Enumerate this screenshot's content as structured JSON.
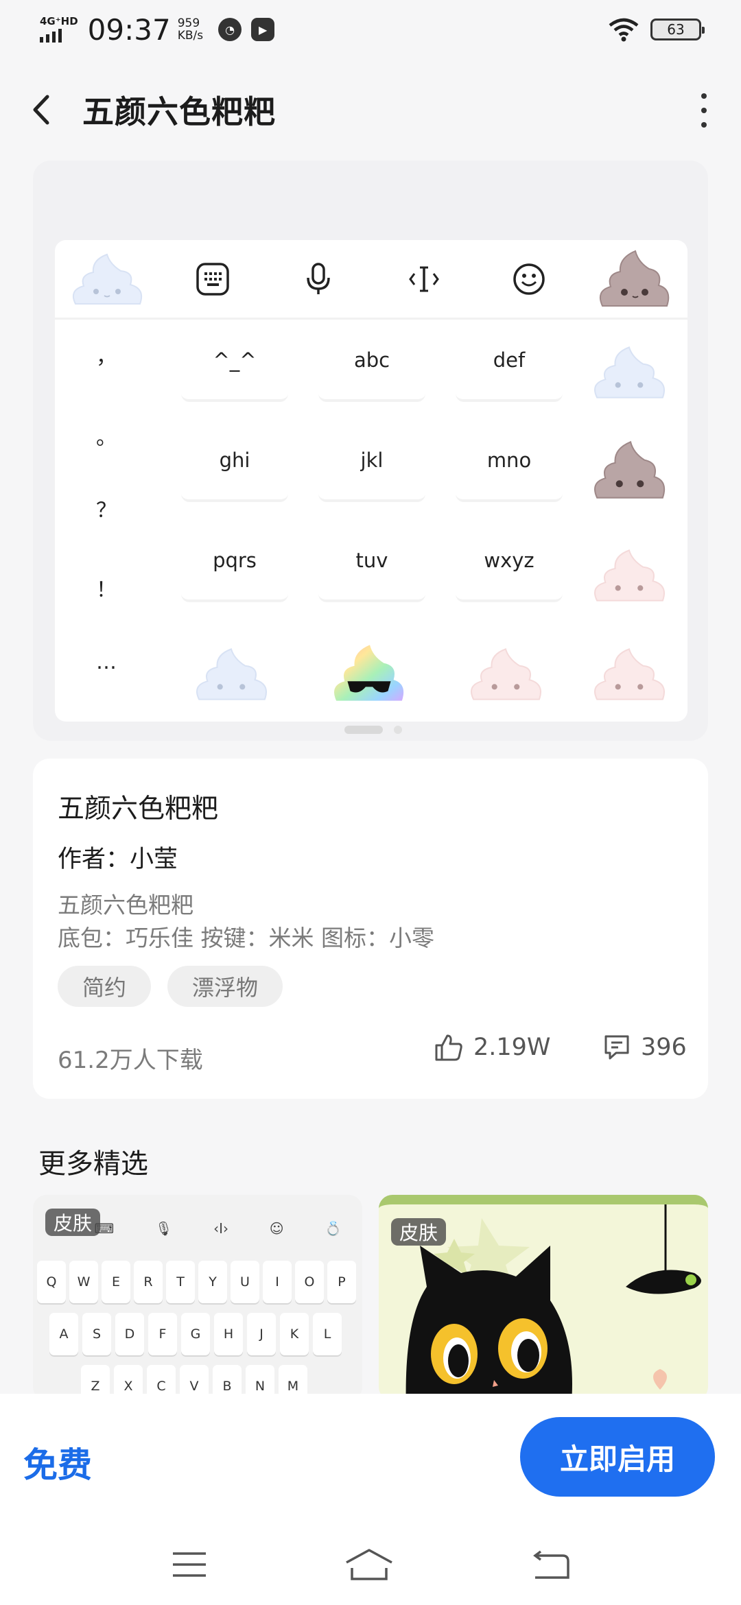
{
  "status": {
    "network": "4G⁺HD",
    "time": "09:37",
    "speed_value": "959",
    "speed_unit": "KB/s",
    "battery": "63"
  },
  "header": {
    "title": "五颜六色粑粑"
  },
  "keyboard": {
    "toolbar": [
      "poop-icon",
      "keyboard-icon",
      "mic-icon",
      "cursor-icon",
      "emoji-icon",
      "poop-icon"
    ],
    "symbols": [
      "，",
      "。",
      "？",
      "！",
      "…"
    ],
    "keys": [
      "^_^",
      "abc",
      "def",
      "ghi",
      "jkl",
      "mno",
      "pqrs",
      "tuv",
      "wxyz"
    ]
  },
  "detail": {
    "name": "五颜六色粑粑",
    "author_label": "作者：",
    "author": "小莹",
    "description": "五颜六色粑粑",
    "credits": "底包：巧乐佳  按键：米米  图标：小零",
    "tags": [
      "简约",
      "漂浮物"
    ],
    "downloads": "61.2万人下载",
    "likes": "2.19W",
    "comments": "396"
  },
  "more": {
    "title": "更多精选",
    "items": [
      {
        "badge": "皮肤"
      },
      {
        "badge": "皮肤"
      }
    ],
    "qwerty_row1": [
      "Q",
      "W",
      "E",
      "R",
      "T",
      "Y",
      "U",
      "I",
      "O",
      "P"
    ],
    "qwerty_row2": [
      "A",
      "S",
      "D",
      "F",
      "G",
      "H",
      "J",
      "K",
      "L"
    ],
    "qwerty_row3": [
      "Z",
      "X",
      "C",
      "V",
      "B",
      "N",
      "M"
    ]
  },
  "bottom": {
    "price": "免费",
    "apply": "立即启用"
  },
  "colors": {
    "accent": "#1f6ff0",
    "poop_blue": "#e8effc",
    "poop_brown": "#b6a3a3",
    "poop_pink": "#fbe9e9"
  }
}
